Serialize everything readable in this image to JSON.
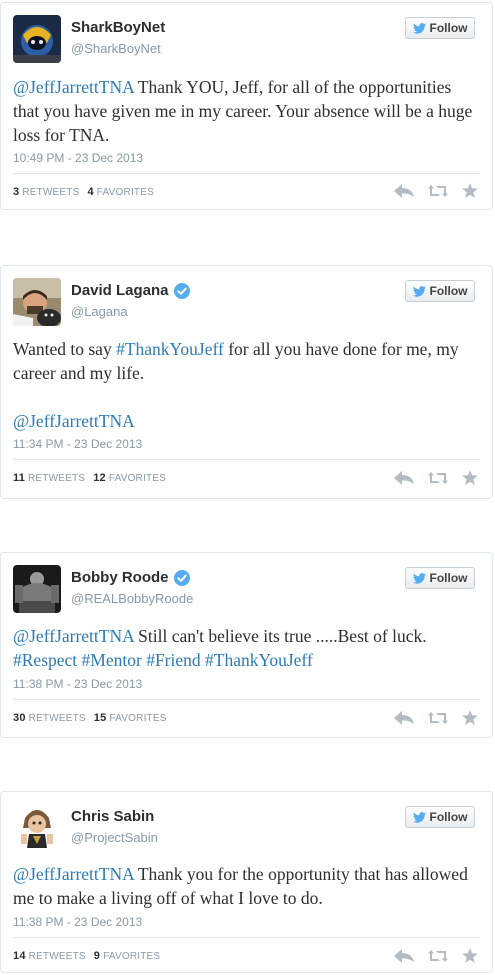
{
  "tweets": [
    {
      "name": "SharkBoyNet",
      "handle": "@SharkBoyNet",
      "verified": false,
      "follow_label": "Follow",
      "text": [
        {
          "t": "@JeffJarrettTNA",
          "link": true
        },
        {
          "t": " Thank YOU, Jeff, for all of the opportunities that you have given me in my career. Your absence will be a huge loss for TNA.",
          "link": false
        }
      ],
      "time": "10:49 PM - 23 Dec 2013",
      "retweets": "3",
      "retweets_label": "RETWEETS",
      "favorites": "4",
      "favorites_label": "FAVORITES"
    },
    {
      "name": "David Lagana",
      "handle": "@Lagana",
      "verified": true,
      "follow_label": "Follow",
      "text": [
        {
          "t": "Wanted to say ",
          "link": false
        },
        {
          "t": "#ThankYouJeff",
          "link": true
        },
        {
          "t": " for all you have done for me, my career and my life.",
          "link": false
        },
        {
          "t": "@JeffJarrettTNA",
          "link": true,
          "para": true
        }
      ],
      "time": "11:34 PM - 23 Dec 2013",
      "retweets": "11",
      "retweets_label": "RETWEETS",
      "favorites": "12",
      "favorites_label": "FAVORITES"
    },
    {
      "name": "Bobby Roode",
      "handle": "@REALBobbyRoode",
      "verified": true,
      "follow_label": "Follow",
      "text": [
        {
          "t": "@JeffJarrettTNA",
          "link": true
        },
        {
          "t": " Still can't believe its true .....Best of luck. ",
          "link": false
        },
        {
          "t": "#Respect",
          "link": true
        },
        {
          "t": " ",
          "link": false
        },
        {
          "t": "#Mentor",
          "link": true
        },
        {
          "t": " ",
          "link": false
        },
        {
          "t": "#Friend",
          "link": true
        },
        {
          "t": " ",
          "link": false
        },
        {
          "t": "#ThankYouJeff",
          "link": true
        }
      ],
      "time": "11:38 PM - 23 Dec 2013",
      "retweets": "30",
      "retweets_label": "RETWEETS",
      "favorites": "15",
      "favorites_label": "FAVORITES"
    },
    {
      "name": "Chris Sabin",
      "handle": "@ProjectSabin",
      "verified": false,
      "follow_label": "Follow",
      "text": [
        {
          "t": "@JeffJarrettTNA",
          "link": true
        },
        {
          "t": " Thank you for the opportunity that has allowed me to make a living off of what I love to do.",
          "link": false
        }
      ],
      "time": "11:38 PM - 23 Dec 2013",
      "retweets": "14",
      "retweets_label": "RETWEETS",
      "favorites": "9",
      "favorites_label": "FAVORITES"
    }
  ],
  "colors": {
    "link": "#2b7bb9",
    "verified": "#55acee",
    "bird": "#55acee",
    "meta": "#8899a6",
    "text": "#292f33"
  },
  "icons": [
    "twitter-bird-icon",
    "verified-badge-icon",
    "reply-icon",
    "retweet-icon",
    "favorite-star-icon"
  ]
}
